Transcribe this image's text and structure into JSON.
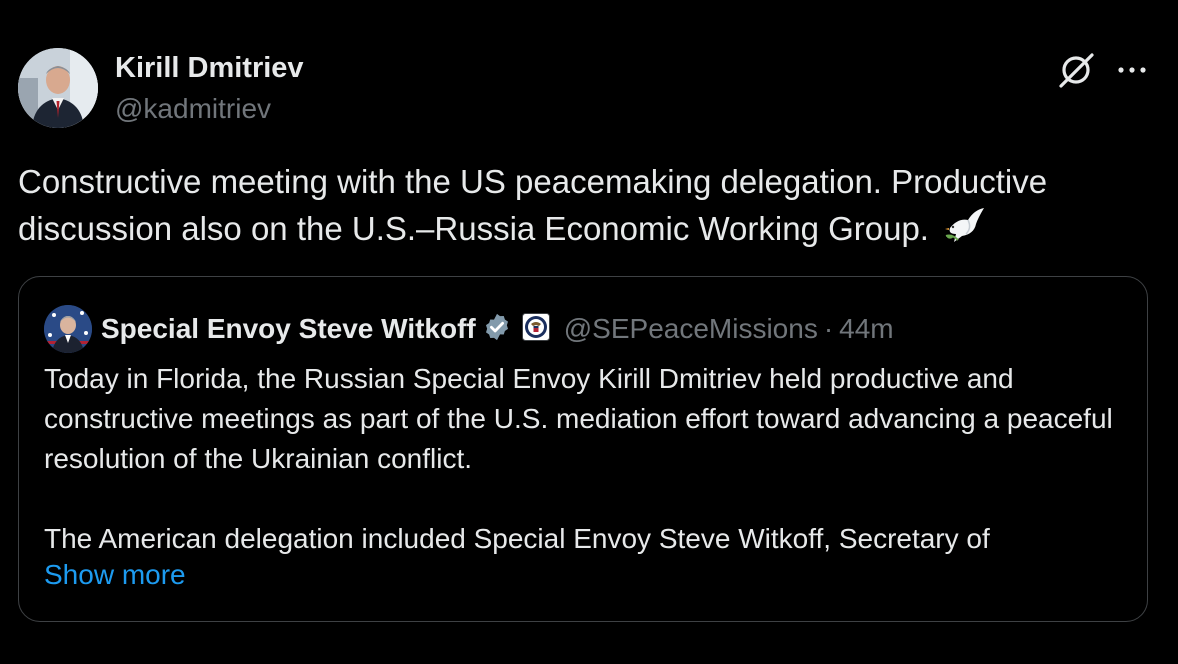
{
  "author": {
    "name": "Kirill Dmitriev",
    "handle": "@kadmitriev"
  },
  "actions": {
    "grok_icon": "grok-icon",
    "more_icon": "more-icon"
  },
  "tweet": {
    "text": "Constructive meeting with the US peacemaking delegation. Productive discussion also on the U.S.–Russia Economic Working Group.",
    "emoji": "dove-emoji"
  },
  "quote": {
    "name": "Special Envoy Steve Witkoff",
    "verified_icon": "verified-badge-icon",
    "affiliation_icon": "us-state-department-seal-icon",
    "handle": "@SEPeaceMissions",
    "separator": "·",
    "time": "44m",
    "paragraphs": [
      "Today in Florida, the Russian Special Envoy Kirill Dmitriev held productive and constructive meetings as part of the U.S. mediation effort toward advancing a peaceful resolution of the Ukrainian conflict.",
      "The American delegation included Special Envoy Steve Witkoff, Secretary of"
    ],
    "show_more": "Show more"
  },
  "colors": {
    "background": "#000000",
    "text_primary": "#e7e9ea",
    "text_secondary": "#71767b",
    "link": "#1d9bf0",
    "border": "#3e4144",
    "verified": "#829aab"
  }
}
